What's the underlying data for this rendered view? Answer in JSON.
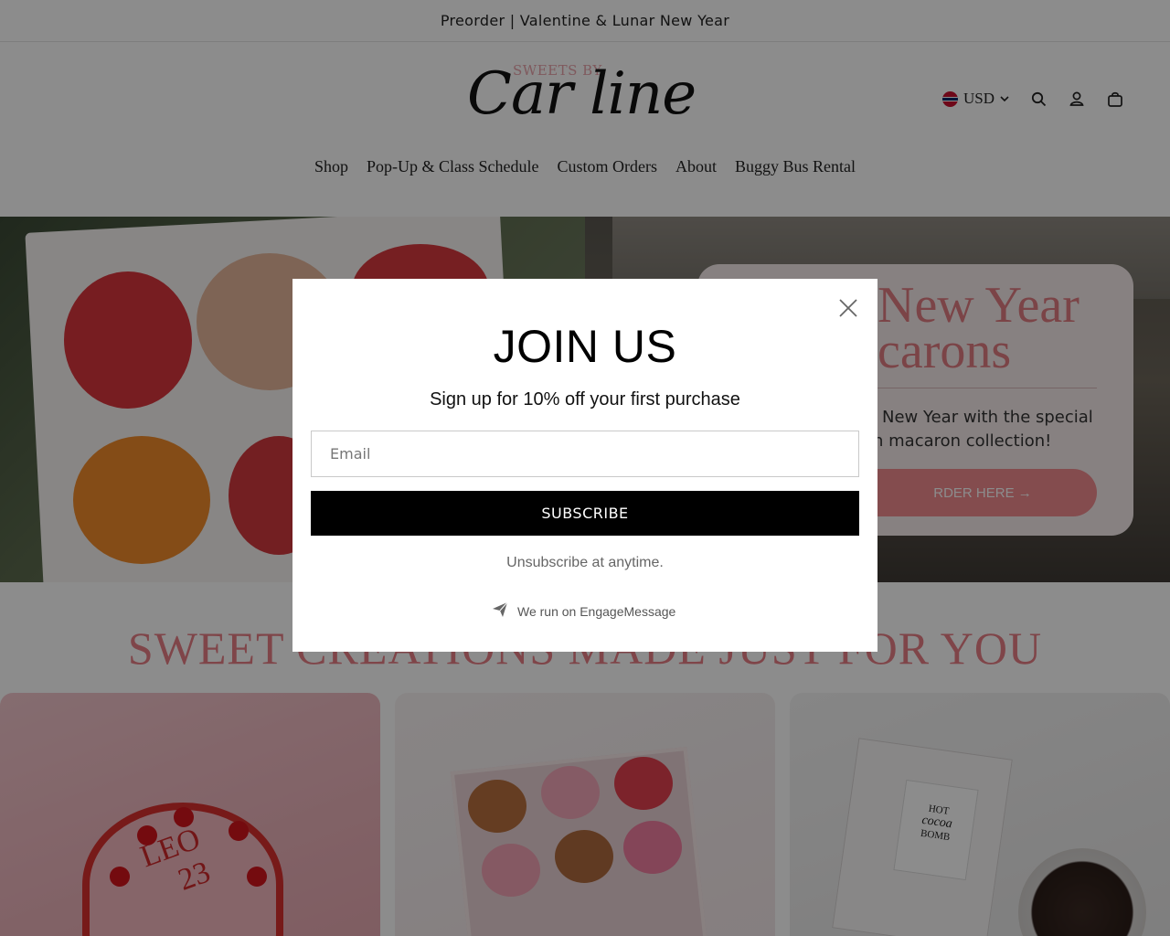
{
  "announcement": {
    "text": "Preorder | Valentine & Lunar New Year"
  },
  "logo": {
    "small": "SWEETS BY",
    "big": "Car line"
  },
  "header": {
    "currency": "USD",
    "icons": [
      "search-icon",
      "account-icon",
      "cart-icon"
    ]
  },
  "nav": {
    "items": [
      {
        "label": "Shop"
      },
      {
        "label": "Pop-Up & Class Schedule"
      },
      {
        "label": "Custom Orders"
      },
      {
        "label": "About"
      },
      {
        "label": "Buggy Bus Rental"
      }
    ]
  },
  "hero": {
    "title_line1": "New Year",
    "title_line2": "carons",
    "desc_line1": "New Year with the special",
    "desc_line2": "n macaron collection!",
    "button": "RDER HERE →"
  },
  "section": {
    "title": "SWEET CREATIONS MADE JUST FOR YOU"
  },
  "cards": {
    "cake_text_1": "LEO",
    "cake_text_2": "23",
    "product_line1": "HOT",
    "product_line2": "cocoa",
    "product_line3": "BOMB"
  },
  "modal": {
    "title": "JOIN US",
    "subtitle": "Sign up for 10% off your first purchase",
    "email_placeholder": "Email",
    "subscribe_label": "SUBSCRIBE",
    "unsubscribe_text": "Unsubscribe at anytime.",
    "powered_by": "We run on EngageMessage"
  },
  "colors": {
    "accent_pink": "#e87f86",
    "button_pink": "#f08a8f",
    "overlay": "rgba(0,0,0,0.45)",
    "subscribe_bg": "#000000"
  }
}
